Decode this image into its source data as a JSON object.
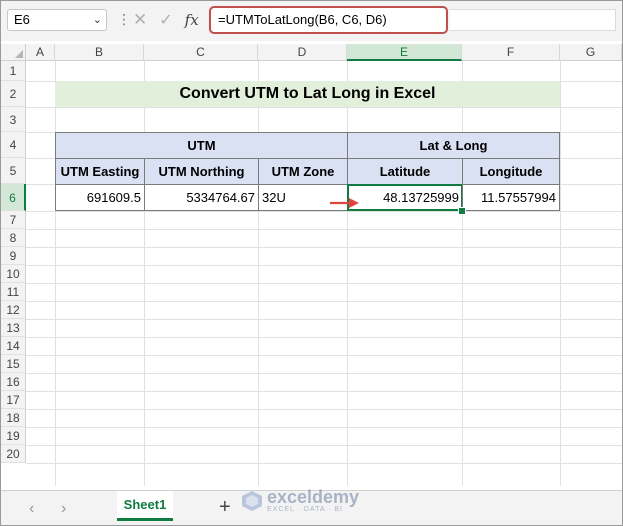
{
  "formula_bar": {
    "name_box": "E6",
    "cancel_icon": "close-icon",
    "enter_icon": "checkmark-icon",
    "fx": "fx",
    "formula": "=UTMToLatLong(B6, C6, D6)"
  },
  "columns": [
    "A",
    "B",
    "C",
    "D",
    "E",
    "F",
    "G"
  ],
  "rows": [
    "1",
    "2",
    "3",
    "4",
    "5",
    "6",
    "7",
    "8",
    "9",
    "10",
    "11",
    "12",
    "13",
    "14",
    "15",
    "16",
    "17",
    "18",
    "19",
    "20"
  ],
  "sheet": {
    "title": "Convert UTM to Lat Long in Excel",
    "group_headers": {
      "utm": "UTM",
      "latlong": "Lat & Long"
    },
    "col_headers": {
      "easting": "UTM Easting",
      "northing": "UTM Northing",
      "zone": "UTM Zone",
      "latitude": "Latitude",
      "longitude": "Longitude"
    },
    "row6": {
      "easting": "691609.5",
      "northing": "5334764.67",
      "zone": "32U",
      "latitude": "48.13725999",
      "longitude": "11.57557994"
    }
  },
  "tabs": {
    "sheet1": "Sheet1",
    "add_icon": "plus-icon",
    "prev_icon": "chevron-left-icon",
    "next_icon": "chevron-right-icon"
  },
  "watermark": {
    "name": "exceldemy",
    "tagline": "EXCEL · DATA · BI"
  },
  "colors": {
    "title_fill": "#e2efda",
    "header_fill": "#d9e1f2",
    "accent": "#107c41",
    "formula_outline": "#c0504d",
    "arrow": "#e0443e"
  }
}
